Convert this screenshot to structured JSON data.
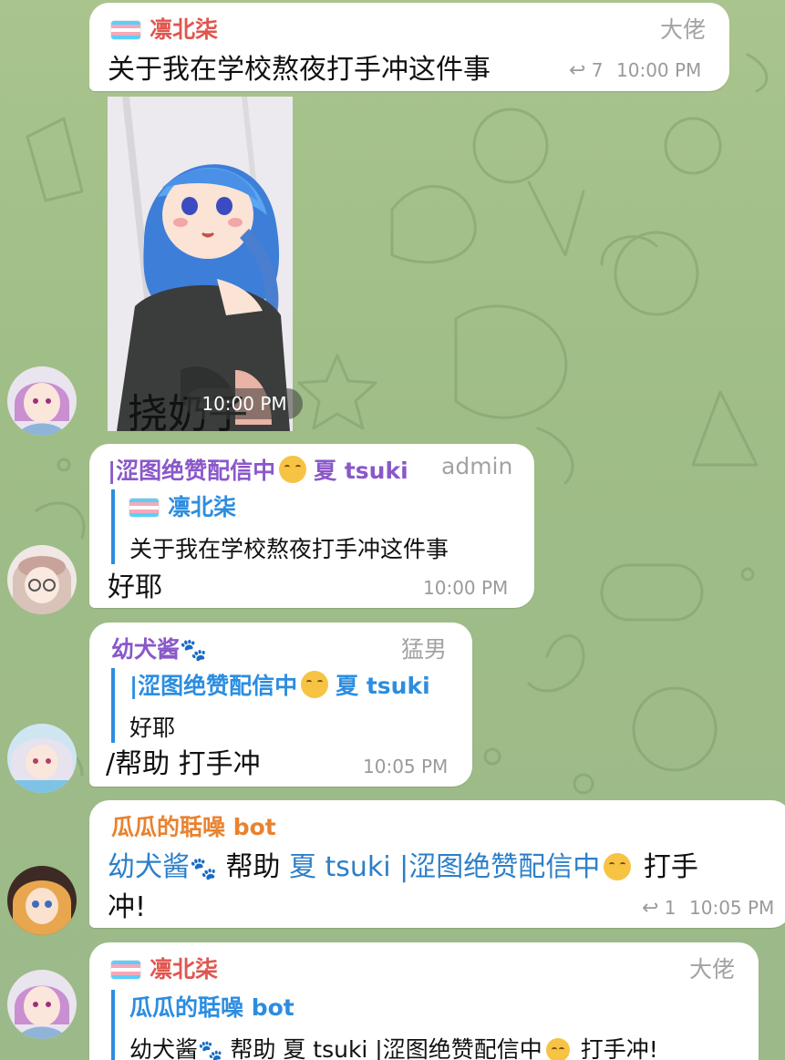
{
  "colors": {
    "background": "#a9c48d",
    "bubble": "#ffffff",
    "name_red": "#e0564f",
    "name_purple": "#8a58c9",
    "name_orange": "#e9822f",
    "quote_blue": "#2c8de0",
    "meta_gray": "#9a9a9a"
  },
  "messages": {
    "m1": {
      "sender": "凛北柒",
      "role": "大佬",
      "text": "关于我在学校熬夜打手冲这件事",
      "replies": "7",
      "time": "10:00 PM"
    },
    "m2": {
      "caption": "挠奶子",
      "time": "10:00 PM"
    },
    "m3": {
      "sender_a": "|涩图绝赞配信中",
      "sender_b": "夏 tsuki",
      "role": "admin",
      "quote_name": "凛北柒",
      "quote_text": "关于我在学校熬夜打手冲这件事",
      "text": "好耶",
      "time": "10:00 PM"
    },
    "m4": {
      "sender": "幼犬酱",
      "role": "猛男",
      "quote_name_a": "|涩图绝赞配信中",
      "quote_name_b": "夏 tsuki",
      "quote_text": "好耶",
      "text": "/帮助 打手冲",
      "time": "10:05 PM"
    },
    "m5": {
      "sender": "瓜瓜的聒噪 bot",
      "mention_1": "幼犬酱",
      "verb": "帮助",
      "mention_2": "夏 tsuki |涩图绝赞配信中",
      "suffix_1": "打手",
      "suffix_2": "冲!",
      "replies": "1",
      "time": "10:05 PM"
    },
    "m6": {
      "sender": "凛北柒",
      "role": "大佬",
      "quote_name": "瓜瓜的聒噪 bot",
      "quote_a": "幼犬酱",
      "quote_b": "帮助 夏 tsuki |涩图绝赞配信中",
      "quote_c": "打手冲!"
    }
  },
  "icons": {
    "reply": "reply-arrow-icon",
    "paw": "paw-prints-icon",
    "drool": "drooling-face-emoji",
    "flag": "transgender-flag-icon"
  }
}
